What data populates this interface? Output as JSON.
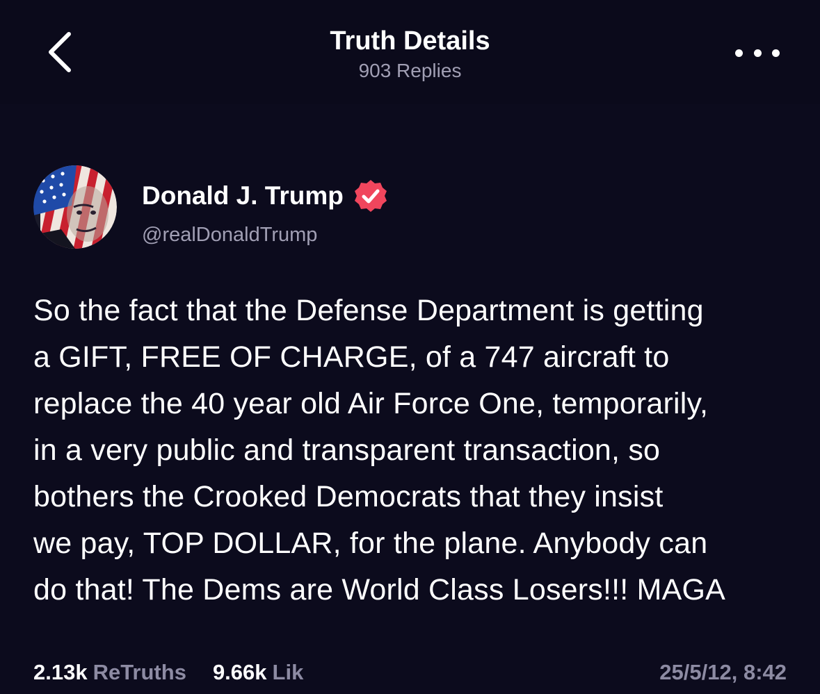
{
  "header": {
    "title": "Truth Details",
    "subtitle": "903 Replies",
    "back_icon": "chevron-left-icon",
    "more_icon": "more-horizontal-icon"
  },
  "author": {
    "name": "Donald J. Trump",
    "handle": "@realDonaldTrump",
    "verified_badge_color": "#f0465d",
    "avatar": "american-flag-face-avatar"
  },
  "post": {
    "lines": [
      "So the fact that the Defense Department is getting",
      "a GIFT, FREE OF CHARGE, of a 747 aircraft to",
      "replace the 40 year old Air Force One, temporarily,",
      "in a very public and transparent transaction, so",
      "bothers the Crooked Democrats that they insist",
      "we pay, TOP DOLLAR, for the plane. Anybody can",
      "do that! The Dems are World Class Losers!!! MAGA"
    ]
  },
  "stats": {
    "retruths_count": "2.13k",
    "retruths_label": "ReTruths",
    "likes_count": "9.66k",
    "likes_label": "Lik"
  },
  "timestamp": "25/5/12, 8:42",
  "colors": {
    "background": "#0c0b1d",
    "muted_text": "#a19fb4",
    "accent": "#f0465d"
  }
}
